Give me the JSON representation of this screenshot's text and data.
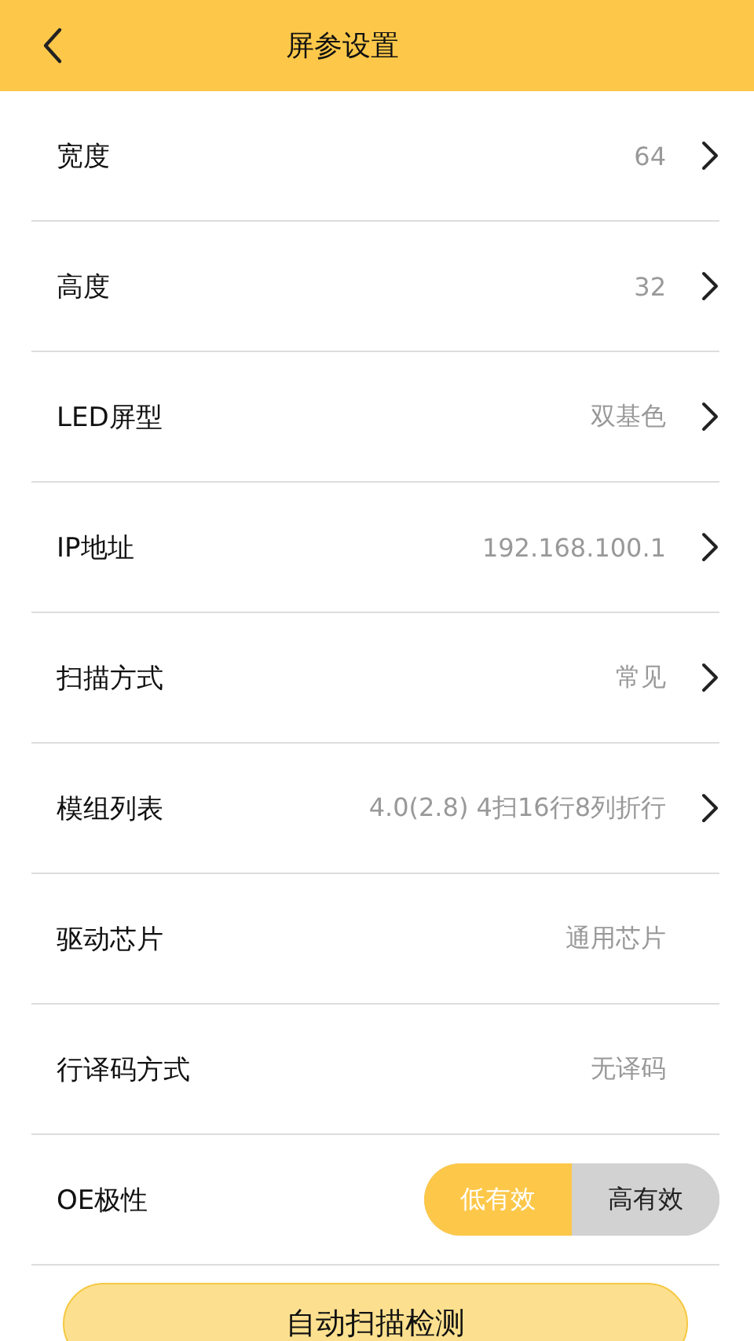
{
  "header": {
    "title": "屏参设置"
  },
  "rows": [
    {
      "kind": "link",
      "label": "宽度",
      "value": "64"
    },
    {
      "kind": "link",
      "label": "高度",
      "value": "32"
    },
    {
      "kind": "link",
      "label": "LED屏型",
      "value": "双基色"
    },
    {
      "kind": "link",
      "label": "IP地址",
      "value": "192.168.100.1"
    },
    {
      "kind": "link",
      "label": "扫描方式",
      "value": "常见"
    },
    {
      "kind": "link",
      "label": "模组列表",
      "value": "4.0(2.8) 4扫16行8列折行"
    },
    {
      "kind": "text",
      "label": "驱动芯片",
      "value": "通用芯片"
    },
    {
      "kind": "text",
      "label": "行译码方式",
      "value": "无译码"
    },
    {
      "kind": "segmented",
      "label": "OE极性",
      "options": [
        {
          "label": "低有效",
          "selected": true
        },
        {
          "label": "高有效",
          "selected": false
        }
      ]
    }
  ],
  "action_button": "自动扫描检测"
}
